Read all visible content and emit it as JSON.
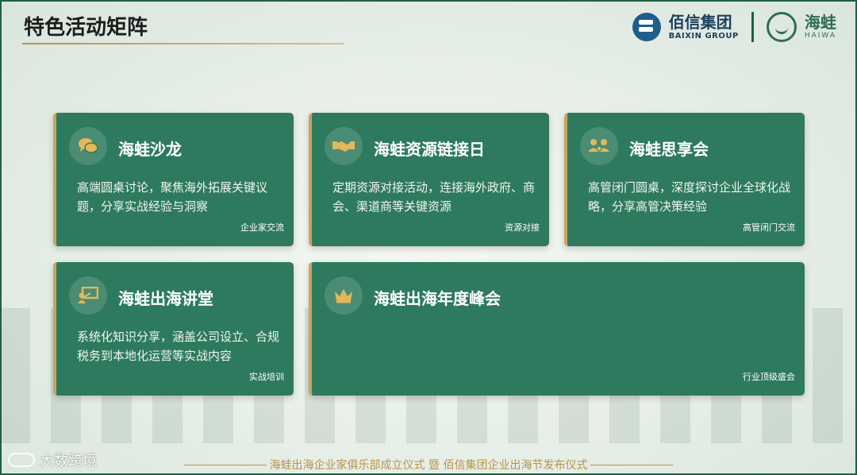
{
  "header": {
    "title": "特色活动矩阵",
    "logo_baixin_cn": "佰信集团",
    "logo_baixin_en": "BAIXIN GROUP",
    "logo_haiwa_cn": "海蛙",
    "logo_haiwa_en": "HAIWA"
  },
  "cards": [
    {
      "title": "海蛙沙龙",
      "desc": "高端圆桌讨论，聚焦海外拓展关键议题，分享实战经验与洞察",
      "tag": "企业家交流",
      "icon": "chat-bubbles-icon"
    },
    {
      "title": "海蛙资源链接日",
      "desc": "定期资源对接活动，连接海外政府、商会、渠道商等关键资源",
      "tag": "资源对接",
      "icon": "handshake-icon"
    },
    {
      "title": "海蛙思享会",
      "desc": "高管闭门圆桌，深度探讨企业全球化战略，分享高管决策经验",
      "tag": "高管闭门交流",
      "icon": "group-people-icon"
    },
    {
      "title": "海蛙出海讲堂",
      "desc": "系统化知识分享，涵盖公司设立、合规税务到本地化运营等实战内容",
      "tag": "实战培训",
      "icon": "lecture-board-icon"
    },
    {
      "title": "海蛙出海年度峰会",
      "desc": "",
      "tag": "行业顶级盛会",
      "icon": "crown-icon"
    }
  ],
  "footer": {
    "text": "海蛙出海企业家俱乐部成立仪式 暨 佰信集团企业出海节发布仪式"
  },
  "watermark": {
    "text": "大数跨境"
  },
  "colors": {
    "card_bg": "#2e7a5e",
    "accent_gold": "#c9a45a",
    "icon_gold": "#e3b85a"
  }
}
